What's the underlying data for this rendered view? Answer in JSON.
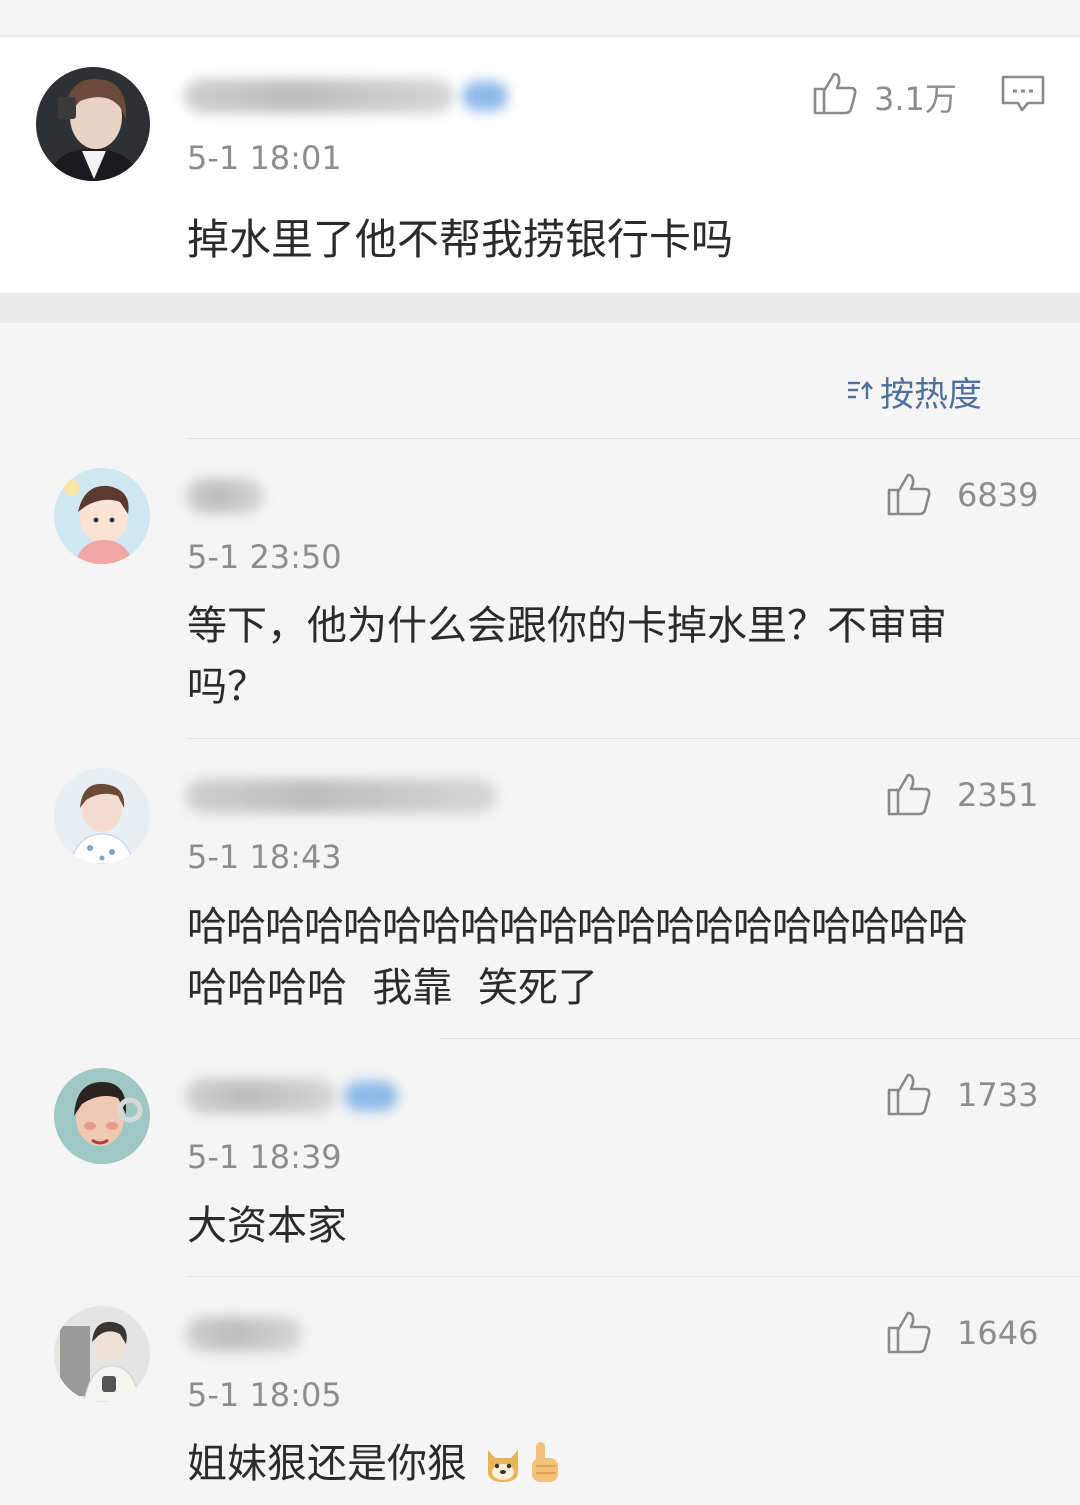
{
  "main_comment": {
    "time": "5-1 18:01",
    "text": "掉水里了他不帮我捞银行卡吗",
    "likes": "3.1万"
  },
  "sort": {
    "label": "按热度",
    "icon": "sort-icon"
  },
  "replies": [
    {
      "time": "5-1 23:50",
      "line1": "等下，他为什么会跟你的卡掉水里？不审审",
      "line2": "吗？",
      "likes": "6839"
    },
    {
      "time": "5-1 18:43",
      "line1": "哈哈哈哈哈哈哈哈哈哈哈哈哈哈哈哈哈哈哈哈",
      "line2": "哈哈哈哈  我靠  笑死了",
      "likes": "2351"
    },
    {
      "time": "5-1 18:39",
      "line1": "大资本家",
      "likes": "1733"
    },
    {
      "time": "5-1 18:05",
      "line1": "姐妹狠还是你狠",
      "likes": "1646",
      "emojis": [
        "doge-emoji",
        "thumbs-up-emoji"
      ]
    }
  ]
}
